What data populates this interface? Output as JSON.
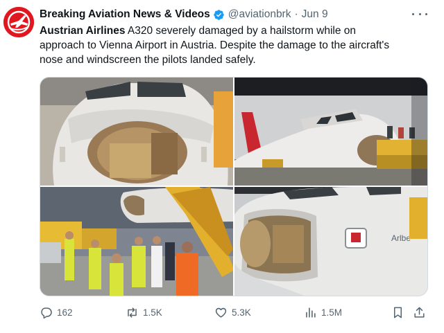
{
  "account": {
    "name": "Breaking Aviation News & Videos",
    "handle": "@aviationbrk",
    "separator": "·",
    "date": "Jun 9",
    "avatar_icon": "airplane-logo-icon",
    "brand_color": "#e0171f",
    "verified_color": "#1d9bf0"
  },
  "tweet": {
    "bold_lead": "Austrian Airlines",
    "text_line1_rest": " A320 severely damaged by a hailstorm while on",
    "text_line2": "approach to Vienna Airport in Austria. Despite the damage to the aircraft's",
    "text_line3": "nose and windscreen the pilots landed safely."
  },
  "media": {
    "photos": [
      {
        "icon": "photo-nose-closeup"
      },
      {
        "icon": "photo-aircraft-side"
      },
      {
        "icon": "photo-ground-crew"
      },
      {
        "icon": "photo-nose-open-radome"
      }
    ],
    "fuselage_text": "Arlbe"
  },
  "actions": {
    "replies": "162",
    "reposts": "1.5K",
    "likes": "5.3K",
    "views": "1.5M"
  }
}
